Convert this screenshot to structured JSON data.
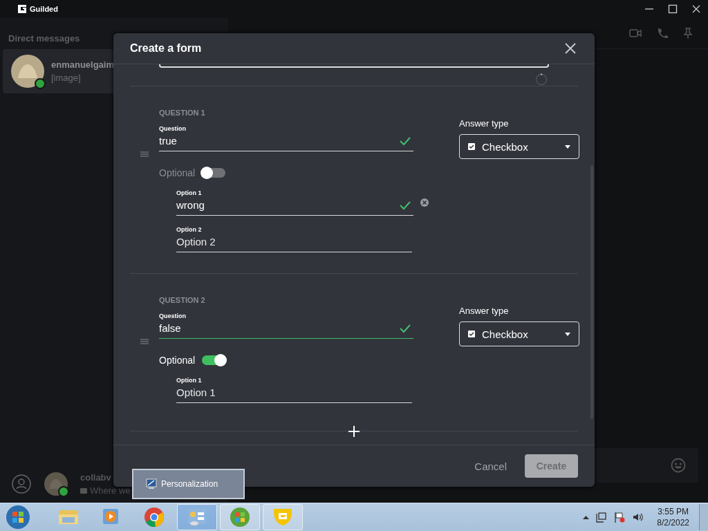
{
  "app": {
    "title": "Guilded"
  },
  "sidebar": {
    "heading": "Direct messages",
    "conversations": [
      {
        "name": "enmanuelgaim",
        "preview": "[image]",
        "online": true,
        "selected": true
      }
    ],
    "user": {
      "name": "collabv",
      "status": "Where we",
      "online": true
    }
  },
  "dialog": {
    "title": "Create a form",
    "questions": [
      {
        "label": "QUESTION 1",
        "field_label": "Question",
        "value": "true",
        "valid": true,
        "focused": false,
        "answer_type_label": "Answer type",
        "answer_type": "Checkbox",
        "optional_label": "Optional",
        "optional": false,
        "options": [
          {
            "label": "Option 1",
            "value": "wrong",
            "valid": true,
            "removable": true
          },
          {
            "label": "Option 2",
            "placeholder": "Option 2",
            "valid": false,
            "removable": false
          }
        ]
      },
      {
        "label": "QUESTION 2",
        "field_label": "Question",
        "value": "false",
        "valid": true,
        "focused": true,
        "answer_type_label": "Answer type",
        "answer_type": "Checkbox",
        "optional_label": "Optional",
        "optional": true,
        "options": [
          {
            "label": "Option 1",
            "placeholder": "Option 1",
            "valid": false,
            "removable": false
          }
        ]
      }
    ],
    "buttons": [
      {
        "label": "Cancel",
        "kind": "link",
        "disabled": false
      },
      {
        "label": "Create",
        "kind": "primary",
        "disabled": true
      }
    ]
  },
  "tooltip": {
    "label": "Personalization"
  },
  "taskbar": {
    "apps": [
      {
        "kind": "explorer",
        "running": false,
        "selected": false
      },
      {
        "kind": "media",
        "running": false,
        "selected": false
      },
      {
        "kind": "chrome",
        "running": false,
        "selected": false
      },
      {
        "kind": "control",
        "running": true,
        "selected": true
      },
      {
        "kind": "orb",
        "running": true,
        "selected": false
      },
      {
        "kind": "guilded",
        "running": true,
        "selected": false
      }
    ],
    "time": "3:55 PM",
    "date": "8/2/2022"
  }
}
